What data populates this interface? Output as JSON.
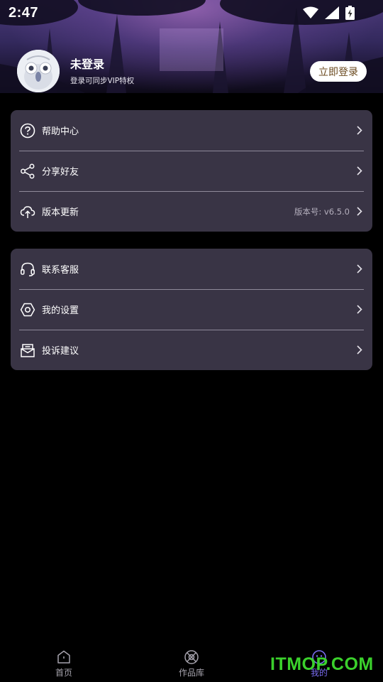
{
  "status_bar": {
    "time": "2:47"
  },
  "profile": {
    "name": "未登录",
    "subtitle": "登录可同步VIP特权",
    "login_button": "立即登录"
  },
  "groups": [
    {
      "items": [
        {
          "icon": "help-circle-icon",
          "label": "帮助中心",
          "value": ""
        },
        {
          "icon": "share-icon",
          "label": "分享好友",
          "value": ""
        },
        {
          "icon": "upload-cloud-icon",
          "label": "版本更新",
          "value": "版本号: v6.5.0"
        }
      ]
    },
    {
      "items": [
        {
          "icon": "headset-icon",
          "label": "联系客服",
          "value": ""
        },
        {
          "icon": "settings-hexagon-icon",
          "label": "我的设置",
          "value": ""
        },
        {
          "icon": "feedback-inbox-icon",
          "label": "投诉建议",
          "value": ""
        }
      ]
    }
  ],
  "tabbar": {
    "tabs": [
      {
        "icon": "home-icon",
        "label": "首页"
      },
      {
        "icon": "library-icon",
        "label": "作品库"
      },
      {
        "icon": "profile-face-icon",
        "label": "我的"
      }
    ],
    "active_index": 2
  },
  "watermark": "ITMOP.COM",
  "colors": {
    "card": "#393445",
    "accent": "#7a6cf0",
    "watermark": "#3bd12c"
  }
}
